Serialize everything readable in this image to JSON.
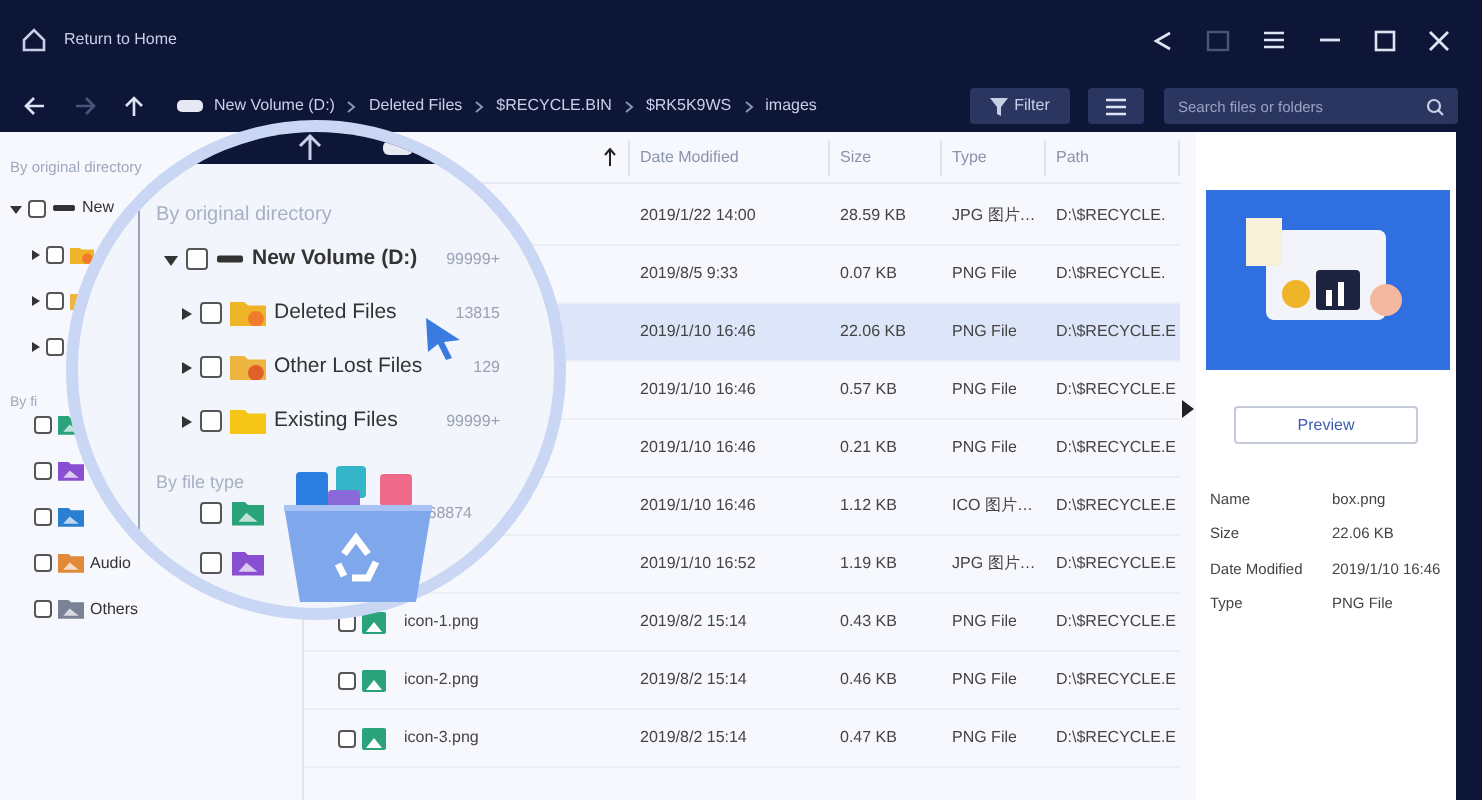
{
  "title_bar": {
    "home_label": "Return to Home"
  },
  "toolbar": {
    "breadcrumb": [
      "New Volume (D:)",
      "Deleted Files",
      "$RECYCLE.BIN",
      "$RK5K9WS",
      "images"
    ],
    "filter_label": "Filter",
    "search_placeholder": "Search files or folders"
  },
  "sidebar": {
    "heading": "By original directory",
    "tree": [
      {
        "label": "New",
        "expanded": true,
        "checked": false,
        "children": [
          {
            "kind": "deleted",
            "expanded": false,
            "checked": false
          },
          {
            "kind": "lost",
            "expanded": false,
            "checked": false
          },
          {
            "kind": "existing",
            "expanded": false,
            "checked": false
          }
        ]
      }
    ],
    "type_heading": "By fi",
    "types": [
      {
        "kind": "image",
        "checked": false
      },
      {
        "kind": "video",
        "checked": false
      },
      {
        "kind": "document",
        "checked": false
      },
      {
        "kind": "audio",
        "label": "Audio",
        "checked": false
      },
      {
        "kind": "other",
        "label": "Others",
        "checked": false
      }
    ]
  },
  "magnifier": {
    "heading": "By original directory",
    "tree": [
      {
        "label": "New Volume (D:)",
        "count": "99999+",
        "expanded": true,
        "checked": false,
        "children": [
          {
            "kind": "deleted",
            "label": "Deleted Files",
            "count": "13815",
            "expanded": false,
            "checked": false
          },
          {
            "kind": "lost",
            "label": "Other Lost Files",
            "count": "129",
            "expanded": false,
            "checked": false
          },
          {
            "kind": "existing",
            "label": "Existing Files",
            "count": "99999+",
            "expanded": false,
            "checked": false
          }
        ]
      }
    ],
    "type_heading": "By file type",
    "types": [
      {
        "kind": "image",
        "count": "68874",
        "checked": false
      },
      {
        "kind": "video",
        "checked": false
      }
    ]
  },
  "table": {
    "columns": [
      "Date Modified",
      "Size",
      "Type",
      "Path"
    ],
    "rows": [
      {
        "date": "2019/1/22 14:00",
        "size": "28.59 KB",
        "type": "JPG 图片…",
        "path": "D:\\$RECYCLE.",
        "selected": false
      },
      {
        "date": "2019/8/5 9:33",
        "size": "0.07 KB",
        "type": "PNG File",
        "path": "D:\\$RECYCLE.",
        "selected": false
      },
      {
        "date": "2019/1/10 16:46",
        "size": "22.06 KB",
        "type": "PNG File",
        "path": "D:\\$RECYCLE.E",
        "selected": true
      },
      {
        "date": "2019/1/10 16:46",
        "size": "0.57 KB",
        "type": "PNG File",
        "path": "D:\\$RECYCLE.E",
        "selected": false
      },
      {
        "date": "2019/1/10 16:46",
        "size": "0.21 KB",
        "type": "PNG File",
        "path": "D:\\$RECYCLE.E",
        "selected": false
      },
      {
        "date": "2019/1/10 16:46",
        "size": "1.12 KB",
        "type": "ICO 图片…",
        "path": "D:\\$RECYCLE.E",
        "selected": false
      },
      {
        "date": "2019/1/10 16:52",
        "size": "1.19 KB",
        "type": "JPG 图片…",
        "path": "D:\\$RECYCLE.E",
        "selected": false
      },
      {
        "name": "icon-1.png",
        "date": "2019/8/2 15:14",
        "size": "0.43 KB",
        "type": "PNG File",
        "path": "D:\\$RECYCLE.E",
        "selected": false
      },
      {
        "name": "icon-2.png",
        "date": "2019/8/2 15:14",
        "size": "0.46 KB",
        "type": "PNG File",
        "path": "D:\\$RECYCLE.E",
        "selected": false
      },
      {
        "name": "icon-3.png",
        "date": "2019/8/2 15:14",
        "size": "0.47 KB",
        "type": "PNG File",
        "path": "D:\\$RECYCLE.E",
        "selected": false
      }
    ]
  },
  "details": {
    "button": "Preview",
    "properties": [
      {
        "label": "Name",
        "value": "box.png"
      },
      {
        "label": "Size",
        "value": "22.06 KB"
      },
      {
        "label": "Date Modified",
        "value": "2019/1/10 16:46"
      },
      {
        "label": "Type",
        "value": "PNG File"
      }
    ]
  }
}
